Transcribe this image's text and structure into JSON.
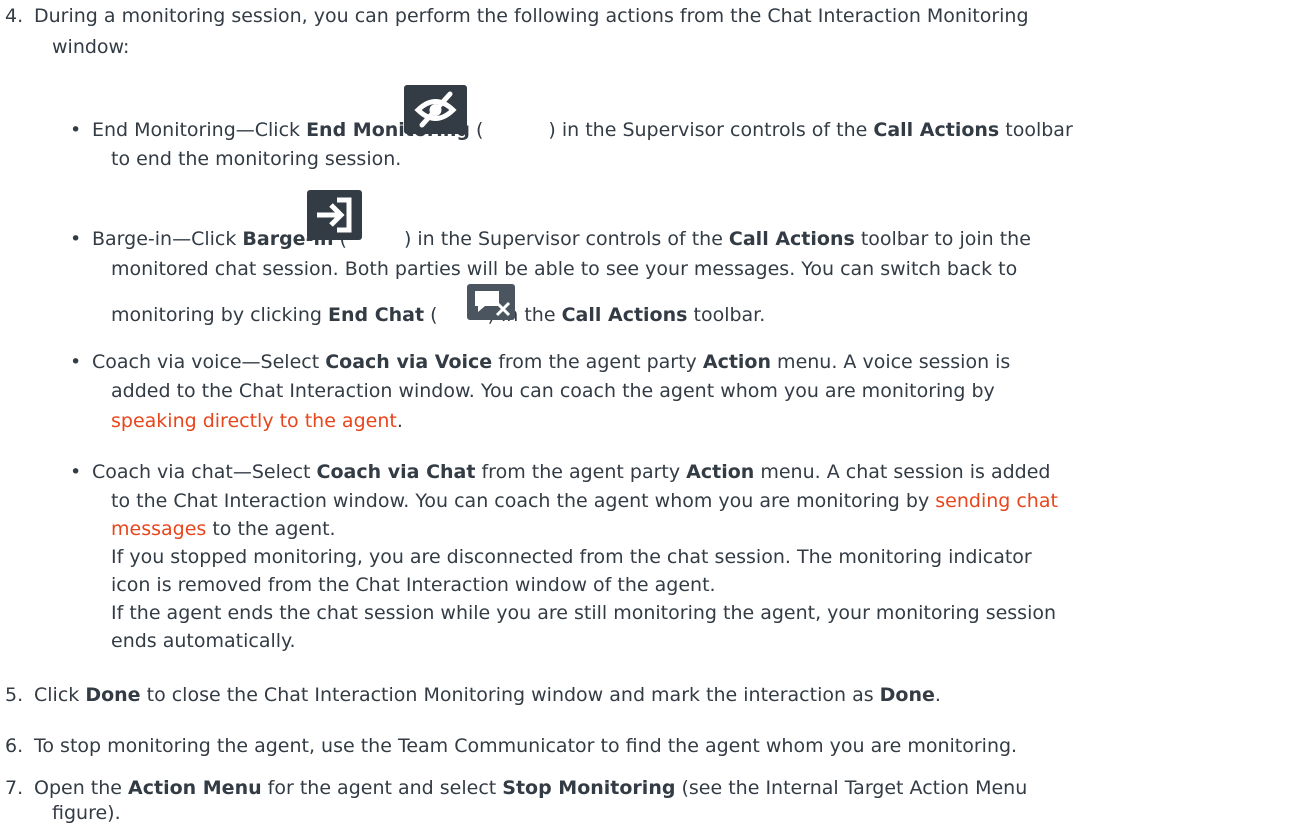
{
  "step4": {
    "number": "4.",
    "line1": "During a monitoring session, you can perform the following actions from the Chat Interaction Monitoring",
    "line2": "window:"
  },
  "bullet_char": "•",
  "b1": {
    "t1": "End Monitoring—Click ",
    "b1": "End Monitoring",
    "t2": " (",
    "t3": ") in the Supervisor controls of the ",
    "b2": "Call Actions",
    "t4": " toolbar",
    "line2": "to end the monitoring session.",
    "icon": "eye-slash-icon"
  },
  "b2": {
    "t1": "Barge-in—Click ",
    "b1": "Barge-in",
    "t2": " (",
    "t3": ") in the Supervisor controls of the ",
    "b2": "Call Actions",
    "t4": " toolbar to join the",
    "line2": "monitored chat session. Both parties will be able to see your messages. You can switch back to",
    "l3a": "monitoring by clicking ",
    "l3b": "End Chat",
    "l3c": " (",
    "l3d": ") in the ",
    "l3e": "Call Actions",
    "l3f": " toolbar.",
    "icon1": "barge-in-icon",
    "icon2": "end-chat-icon"
  },
  "b3": {
    "t1": "Coach via voice—Select ",
    "b1": "Coach via Voice",
    "t2": " from the agent party ",
    "b2": "Action",
    "t3": " menu. A voice session is",
    "line2": "added to the Chat Interaction window. You can coach the agent whom you are monitoring by",
    "link": "speaking directly to the agent",
    "line3end": "."
  },
  "b4": {
    "t1": "Coach via chat—Select ",
    "b1": "Coach via Chat",
    "t2": " from the agent party ",
    "b2": "Action",
    "t3": " menu. A chat session is added",
    "line2a": "to the Chat Interaction window. You can coach the agent whom you are monitoring by ",
    "link1": "sending chat",
    "link2": "messages",
    "line3end": " to the agent.",
    "line4": "If you stopped monitoring, you are disconnected from the chat session. The monitoring indicator",
    "line5": "icon is removed from the Chat Interaction window of the agent.",
    "line6": "If the agent ends the chat session while you are still monitoring the agent, your monitoring session",
    "line7": "ends automatically."
  },
  "step5": {
    "number": "5.",
    "t1": "Click ",
    "b1": "Done",
    "t2": " to close the Chat Interaction Monitoring window and mark the interaction as ",
    "b2": "Done",
    "t3": "."
  },
  "step6": {
    "number": "6.",
    "text": "To stop monitoring the agent, use the Team Communicator to find the agent whom you are monitoring."
  },
  "step7": {
    "number": "7.",
    "t1": "Open the ",
    "b1": "Action Menu",
    "t2": " for the agent and select ",
    "b2": "Stop Monitoring",
    "t3": " (see the Internal Target Action Menu",
    "line2": "figure)."
  }
}
